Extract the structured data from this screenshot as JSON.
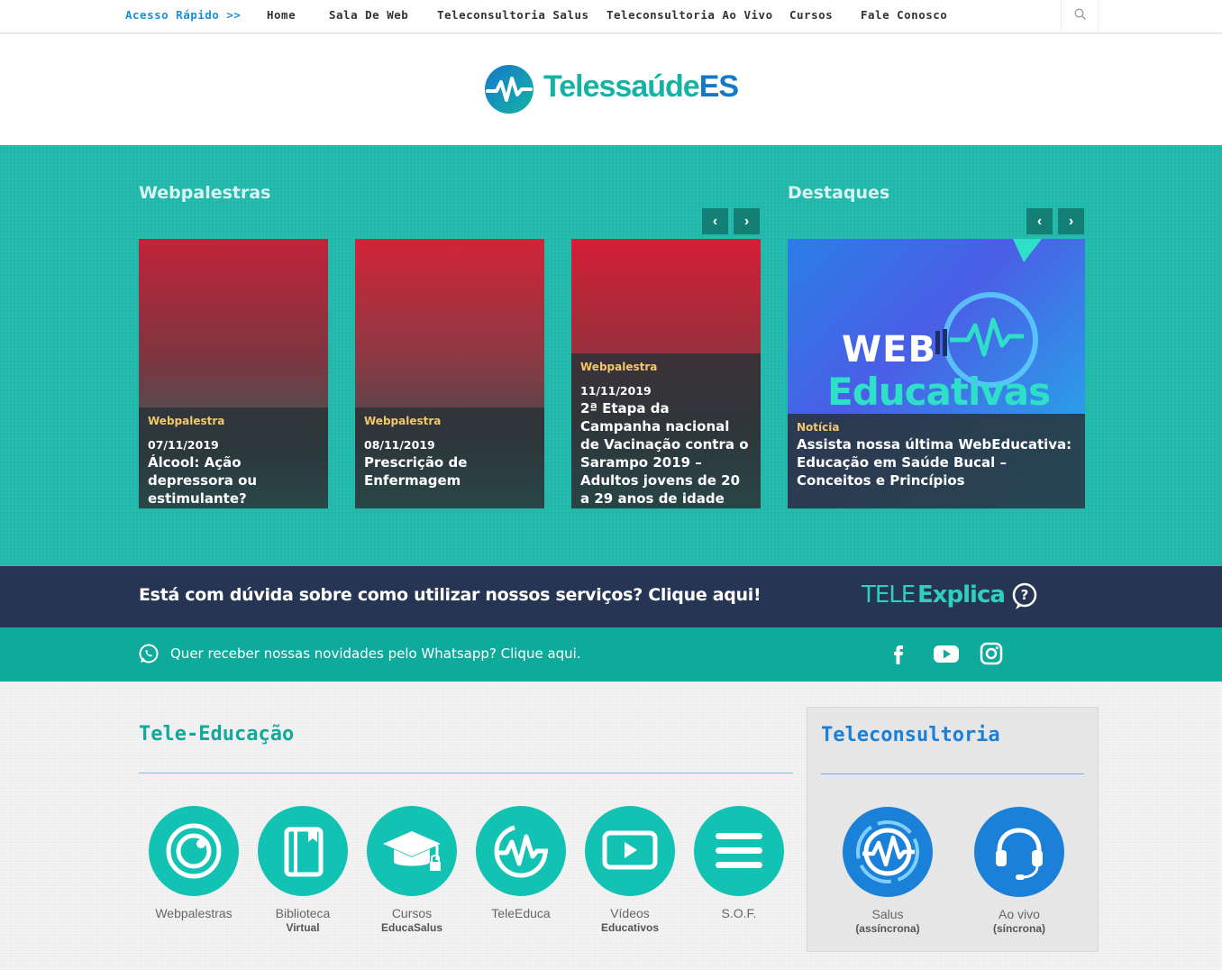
{
  "nav": {
    "quick_access": "Acesso Rápido >>",
    "items": [
      "Home",
      "Sala De Web",
      "Teleconsultoria Salus",
      "Teleconsultoria Ao Vivo",
      "Cursos",
      "Fale Conosco"
    ],
    "search_icon": "search-icon"
  },
  "header": {
    "logo_main": "Telessaúde",
    "logo_suffix": "ES"
  },
  "webpalestras": {
    "title": "Webpalestras",
    "cards": [
      {
        "category": "Webpalestra",
        "date": "07/11/2019",
        "title": "Álcool: Ação depressora ou estimulante?"
      },
      {
        "category": "Webpalestra",
        "date": "08/11/2019",
        "title": "Prescrição de Enfermagem"
      },
      {
        "category": "Webpalestra",
        "date": "11/11/2019",
        "title": "2ª Etapa da Campanha nacional de Vacinação contra o Sarampo 2019 – Adultos jovens de 20 a 29 anos de idade"
      }
    ]
  },
  "destaques": {
    "title": "Destaques",
    "image_text_1": "WEB",
    "image_text_2": "Educativas",
    "category": "Notícia",
    "headline": "Assista nossa última WebEducativa: Educação em Saúde Bucal – Conceitos e Princípios"
  },
  "help_bar": {
    "question": "Está com dúvida sobre como utilizar nossos serviços? Clique aqui!",
    "brand_1": "TELE",
    "brand_2": "Explica"
  },
  "whatsapp_bar": {
    "text": "Quer receber nossas novidades pelo Whatsapp? Clique aqui.",
    "social": [
      "facebook-icon",
      "youtube-icon",
      "instagram-icon"
    ]
  },
  "tele_educacao": {
    "title": "Tele-Educação",
    "items": [
      {
        "label": "Webpalestras",
        "sub": ""
      },
      {
        "label": "Biblioteca",
        "sub": "Virtual"
      },
      {
        "label": "Cursos",
        "sub": "EducaSalus"
      },
      {
        "label": "TeleEduca",
        "sub": ""
      },
      {
        "label": "Vídeos",
        "sub": "Educativos"
      },
      {
        "label": "S.O.F.",
        "sub": ""
      }
    ]
  },
  "teleconsultoria": {
    "title": "Teleconsultoria",
    "items": [
      {
        "label": "Salus",
        "sub": "(assíncrona)"
      },
      {
        "label": "Ao vivo",
        "sub": "(síncrona)"
      }
    ]
  },
  "colors": {
    "teal": "#20b8aa",
    "teal_dark": "#137f75",
    "navy": "#263553",
    "blue": "#1479c9",
    "circle_teal": "#12c2b2",
    "circle_blue": "#1a80d8"
  }
}
